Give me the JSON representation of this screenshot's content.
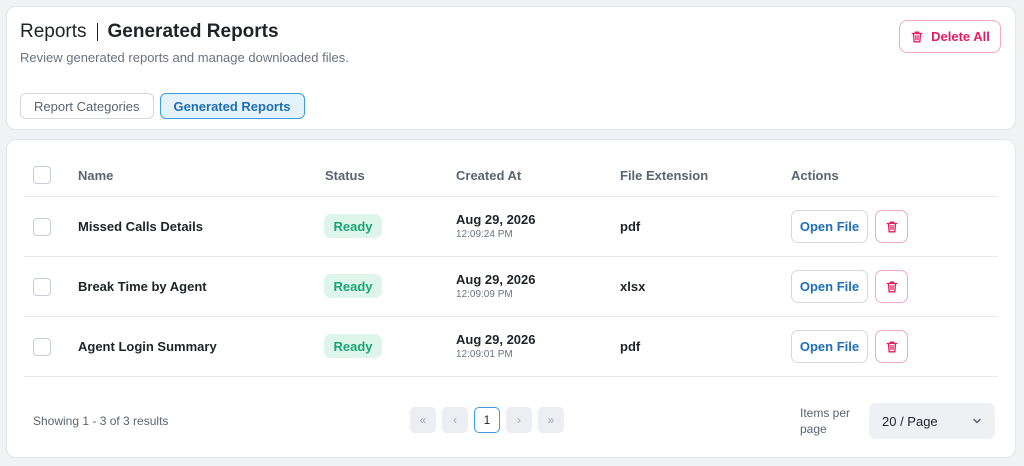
{
  "header": {
    "breadcrumb_root": "Reports",
    "title": "Generated Reports",
    "subtitle": "Review generated reports and manage downloaded files.",
    "delete_all_label": "Delete All"
  },
  "tabs": [
    {
      "label": "Report Categories",
      "active": false
    },
    {
      "label": "Generated Reports",
      "active": true
    }
  ],
  "table": {
    "columns": [
      "Name",
      "Status",
      "Created At",
      "File Extension",
      "Actions"
    ],
    "rows": [
      {
        "name": "Missed Calls Details",
        "status": "Ready",
        "date": "Aug 29, 2026",
        "time": "12:09:24 PM",
        "ext": "pdf",
        "open_label": "Open File"
      },
      {
        "name": "Break Time by Agent",
        "status": "Ready",
        "date": "Aug 29, 2026",
        "time": "12:09:09 PM",
        "ext": "xlsx",
        "open_label": "Open File"
      },
      {
        "name": "Agent Login Summary",
        "status": "Ready",
        "date": "Aug 29, 2026",
        "time": "12:09:01 PM",
        "ext": "pdf",
        "open_label": "Open File"
      }
    ]
  },
  "footer": {
    "showing": "Showing 1 - 3 of 3 results",
    "pager": {
      "first": "«",
      "prev": "‹",
      "current_page": "1",
      "next": "›",
      "last": "»"
    },
    "items_per_page_label": "Items per page",
    "page_size": "20 / Page"
  },
  "colors": {
    "accent": "#3b9be0",
    "danger": "#e11d62",
    "status_ready_bg": "#def5ec",
    "status_ready_text": "#1aa575"
  },
  "icons": {
    "delete": "trash-icon",
    "dropdown": "chevron-down-icon"
  }
}
